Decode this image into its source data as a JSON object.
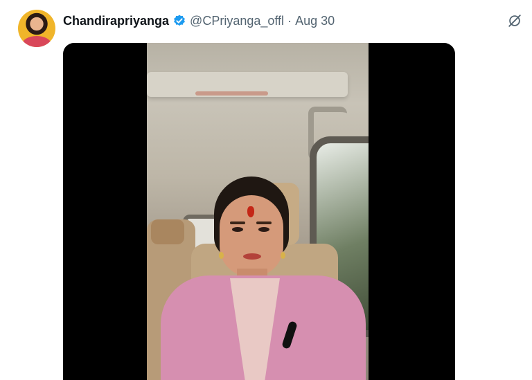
{
  "tweet": {
    "author_name": "Chandirapriyanga",
    "handle": "@CPriyanga_offl",
    "separator": "·",
    "date": "Aug 30"
  },
  "icons": {
    "verified": "verified-badge-icon",
    "more": "grok-slash-icon"
  },
  "colors": {
    "verified": "#1d9bf0",
    "secondary_text": "#536471",
    "media_background": "#000000"
  }
}
